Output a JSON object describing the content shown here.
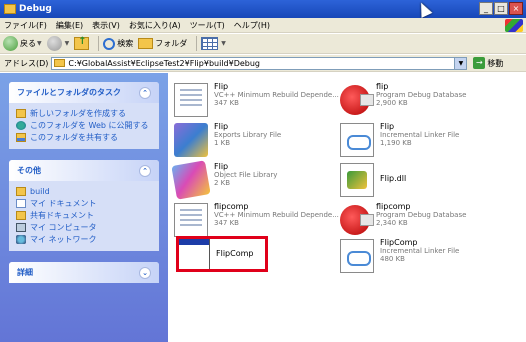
{
  "window": {
    "title": "Debug",
    "buttons": [
      "_",
      "□",
      "×"
    ]
  },
  "menu": [
    "ファイル(F)",
    "編集(E)",
    "表示(V)",
    "お気に入り(A)",
    "ツール(T)",
    "ヘルプ(H)"
  ],
  "toolbar": {
    "back": "戻る",
    "search": "検索",
    "folders": "フォルダ"
  },
  "address": {
    "label": "アドレス(D)",
    "path": "C:¥GlobalAssist¥EclipseTest2¥Flip¥build¥Debug",
    "go": "移動"
  },
  "tasks": {
    "title": "ファイルとフォルダのタスク",
    "items": [
      "新しいフォルダを作成する",
      "このフォルダを Web に公開する",
      "このフォルダを共有する"
    ]
  },
  "places": {
    "title": "その他",
    "items": [
      "build",
      "マイ ドキュメント",
      "共有ドキュメント",
      "マイ コンピュータ",
      "マイ ネットワーク"
    ]
  },
  "details": {
    "title": "詳細"
  },
  "files": [
    {
      "name": "Flip",
      "type": "VC++ Minimum Rebuild Depende...",
      "size": "347 KB",
      "icon": "doc-icon"
    },
    {
      "name": "flip",
      "type": "Program Debug Database",
      "size": "2,900 KB",
      "icon": "debug-db-icon"
    },
    {
      "name": "Flip",
      "type": "Exports Library File",
      "size": "1 KB",
      "icon": "library-icon"
    },
    {
      "name": "Flip",
      "type": "Incremental Linker File",
      "size": "1,190 KB",
      "icon": "linker-icon"
    },
    {
      "name": "Flip",
      "type": "Object File Library",
      "size": "2 KB",
      "icon": "object-library-icon"
    },
    {
      "name": "Flip.dll",
      "type": "",
      "size": "",
      "icon": "dll-icon"
    },
    {
      "name": "flipcomp",
      "type": "VC++ Minimum Rebuild Depende...",
      "size": "347 KB",
      "icon": "doc-icon"
    },
    {
      "name": "flipcomp",
      "type": "Program Debug Database",
      "size": "2,340 KB",
      "icon": "debug-db-icon"
    },
    {
      "name": "FlipComp",
      "type": "",
      "size": "",
      "icon": "exe-icon"
    },
    {
      "name": "FlipComp",
      "type": "Incremental Linker File",
      "size": "480 KB",
      "icon": "linker-icon"
    }
  ],
  "colors": {
    "highlight": "#e0001a",
    "titlebar": "#2d63d8",
    "taskpane": "#7ba2e7"
  }
}
